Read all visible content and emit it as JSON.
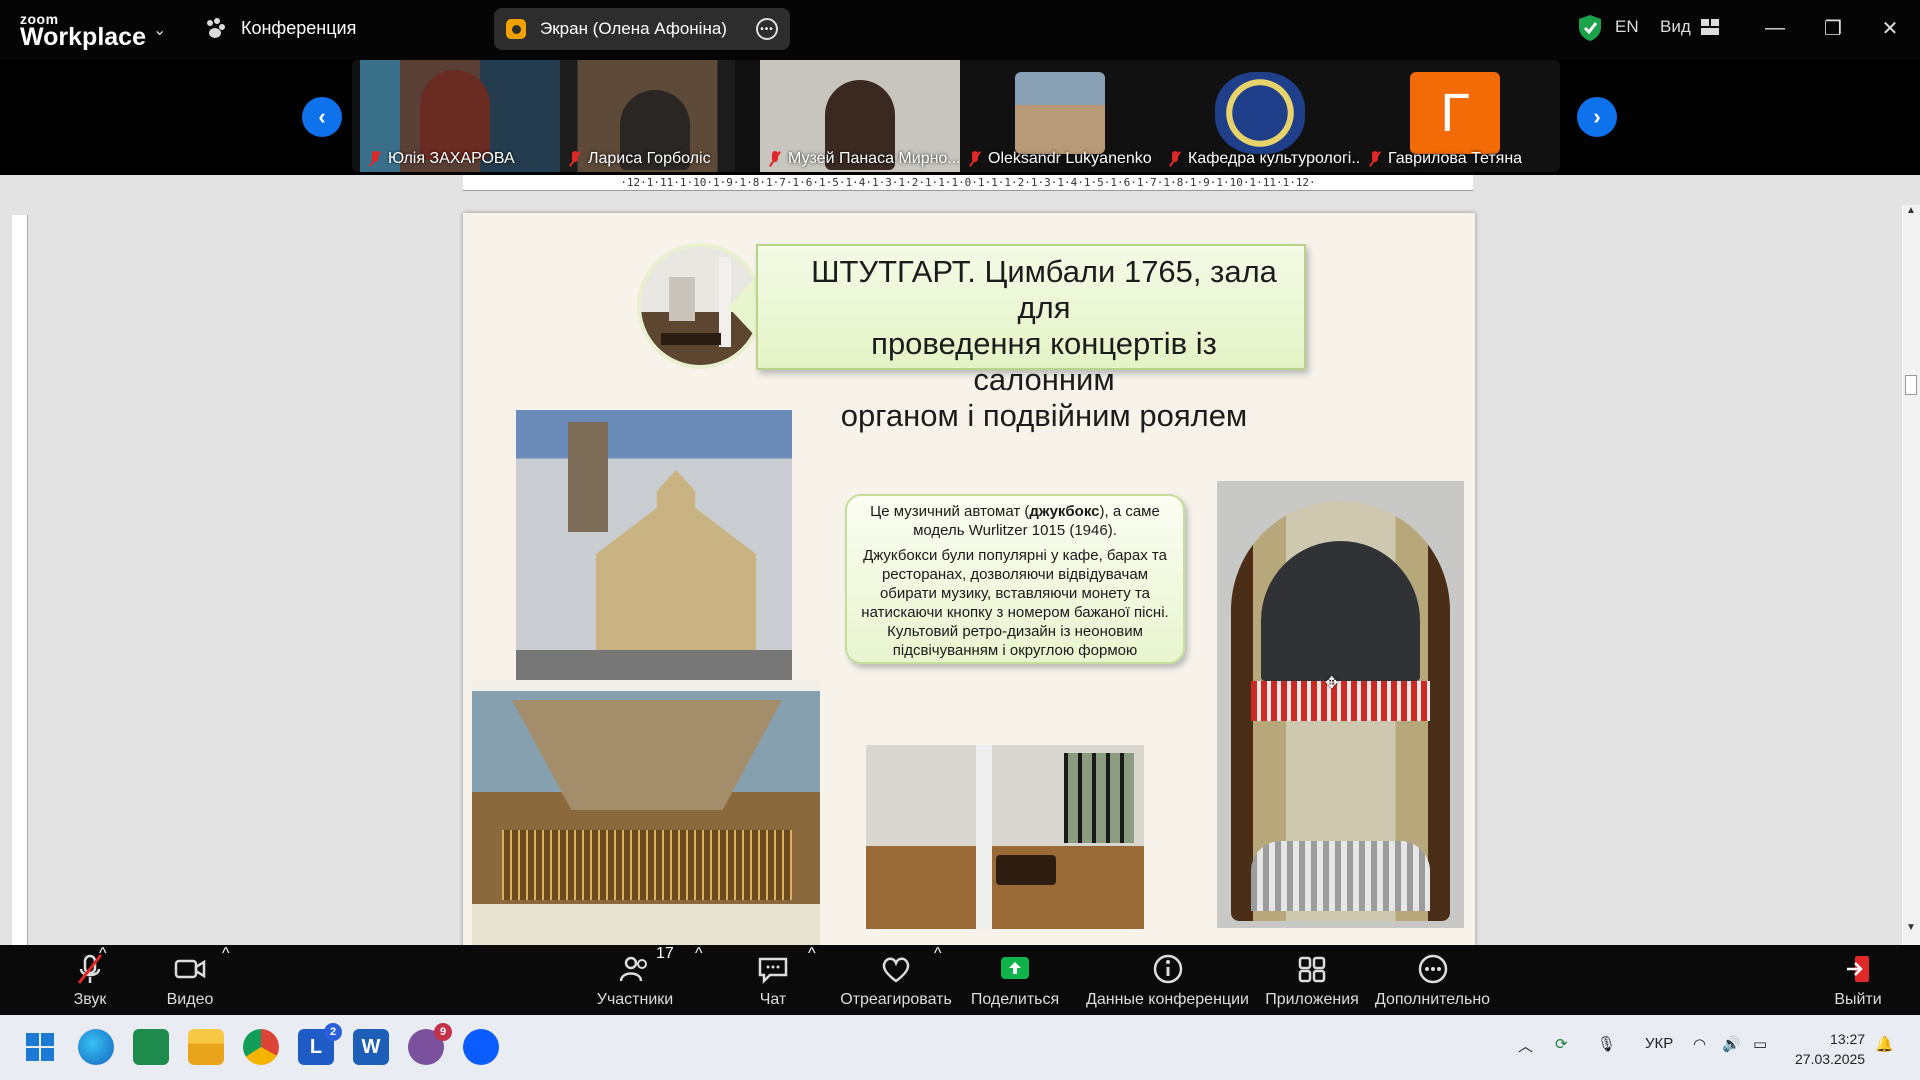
{
  "topbar": {
    "logo_top": "zoom",
    "logo_bottom": "Workplace",
    "meeting_label": "Конференция",
    "screen_share_label": "Экран (Олена Афоніна)",
    "language": "EN",
    "view_label": "Вид",
    "security_color": "#1aa34a"
  },
  "gallery": {
    "prev_icon": "‹",
    "next_icon": "›",
    "participants": [
      {
        "name": "Юлія ЗАХАРОВА",
        "muted": true
      },
      {
        "name": "Лариса Горболіс",
        "muted": true
      },
      {
        "name": "Музей Панаса Мирно...",
        "muted": true
      },
      {
        "name": "Oleksandr Lukyanenko",
        "muted": true
      },
      {
        "name": "Кафедра культурологі...",
        "muted": true
      },
      {
        "name": "Гаврилова Тетяна",
        "muted": true,
        "avatar_letter": "Г",
        "avatar_color": "#f26b06"
      }
    ]
  },
  "document": {
    "ruler_text": "·12·1·11·1·10·1·9·1·8·1·7·1·6·1·5·1·4·1·3·1·2·1·1·1·0·1·1·1·2·1·3·1·4·1·5·1·6·1·7·1·8·1·9·1·10·1·11·1·12·",
    "slide": {
      "title_lines": [
        "ШТУТГАРТ. Цимбали 1765, зала для",
        "проведення концертів із салонним",
        "органом і подвійним роялем"
      ],
      "info_p1_a": "Це музичний автомат (",
      "info_p1_bold": "джукбокс",
      "info_p1_b": "), а саме модель Wurlitzer 1015  (1946).",
      "info_p2": "Джукбокси були популярні у кафе, барах та ресторанах, дозволяючи відвідувачам обирати музику, вставляючи монету та натискаючи кнопку з номером бажаної пісні. Культовий ретро-дизайн із неоновим підсвічуванням і округлою формою"
    }
  },
  "toolbar": {
    "audio": "Звук",
    "video": "Видео",
    "participants": "Участники",
    "participants_count": "17",
    "chat": "Чат",
    "react": "Отреагировать",
    "share": "Поделиться",
    "meeting_info": "Данные конференции",
    "apps": "Приложения",
    "more": "Дополнительно",
    "leave": "Выйти",
    "share_color": "#0eb44a",
    "leave_color": "#e02828"
  },
  "taskbar": {
    "apps": [
      {
        "name": "windows-start"
      },
      {
        "name": "edge"
      },
      {
        "name": "app-green"
      },
      {
        "name": "file-explorer"
      },
      {
        "name": "chrome"
      },
      {
        "name": "l-app",
        "label": "L",
        "badge": "2"
      },
      {
        "name": "word",
        "label": "W"
      },
      {
        "name": "viber",
        "badge": "9"
      },
      {
        "name": "zoom"
      }
    ],
    "tray_lang": "УКР",
    "time": "13:27",
    "date": "27.03.2025"
  }
}
